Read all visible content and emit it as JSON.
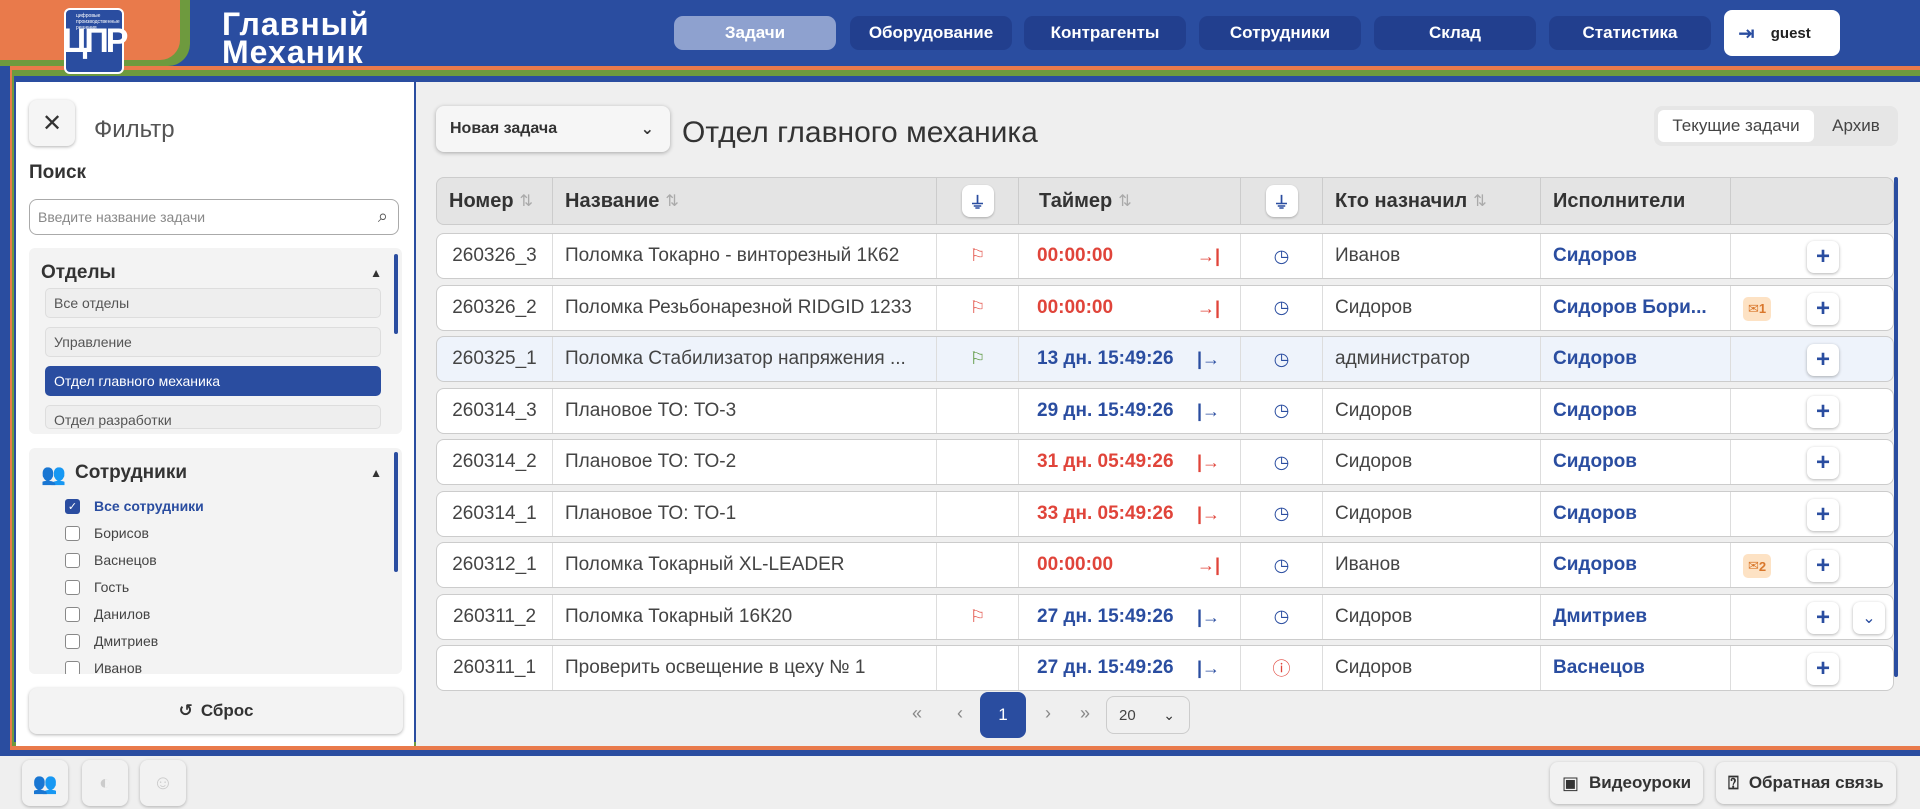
{
  "header": {
    "logo_text": "ЦПР",
    "logo_subtitle": "цифровые производственные решения",
    "brand_line1": "Главный",
    "brand_line2": "Механик",
    "nav": [
      {
        "label": "Задачи",
        "active": true
      },
      {
        "label": "Оборудование",
        "active": false
      },
      {
        "label": "Контрагенты",
        "active": false
      },
      {
        "label": "Сотрудники",
        "active": false
      },
      {
        "label": "Склад",
        "active": false
      },
      {
        "label": "Статистика",
        "active": false
      }
    ],
    "user": "guest"
  },
  "sidebar": {
    "title": "Фильтр",
    "search_label": "Поиск",
    "search_placeholder": "Введите название задачи",
    "departments_title": "Отделы",
    "departments": [
      {
        "label": "Все отделы",
        "selected": false
      },
      {
        "label": "Управление",
        "selected": false
      },
      {
        "label": "Отдел главного механика",
        "selected": true
      },
      {
        "label": "Отдел разработки",
        "selected": false
      }
    ],
    "employees_title": "Сотрудники",
    "employees": [
      {
        "label": "Все сотрудники",
        "checked": true
      },
      {
        "label": "Борисов",
        "checked": false
      },
      {
        "label": "Васнецов",
        "checked": false
      },
      {
        "label": "Гость",
        "checked": false
      },
      {
        "label": "Данилов",
        "checked": false
      },
      {
        "label": "Дмитриев",
        "checked": false
      },
      {
        "label": "Иванов",
        "checked": false
      }
    ],
    "reset_label": "Сброс"
  },
  "main": {
    "new_task_label": "Новая задача",
    "page_title": "Отдел главного механика",
    "tabs": [
      {
        "label": "Текущие задачи",
        "active": true
      },
      {
        "label": "Архив",
        "active": false
      }
    ],
    "columns": {
      "number": "Номер",
      "name": "Название",
      "timer": "Таймер",
      "assigned_by": "Кто назначил",
      "executors": "Исполнители"
    },
    "rows": [
      {
        "number": "260326_3",
        "name": "Поломка Токарно - винторезный 1К62",
        "flag": "red",
        "timer": "00:00:00",
        "timer_color": "red",
        "arrow": "→|",
        "status_icon": "clock",
        "assigned_by": "Иванов",
        "executors": "Сидоров",
        "messages": ""
      },
      {
        "number": "260326_2",
        "name": "Поломка Резьбонарезной RIDGID 1233",
        "flag": "red",
        "timer": "00:00:00",
        "timer_color": "red",
        "arrow": "→|",
        "status_icon": "clock",
        "assigned_by": "Сидоров",
        "executors": "Сидоров  Бори...",
        "messages": "1"
      },
      {
        "number": "260325_1",
        "name": "Поломка Стабилизатор напряжения ...",
        "flag": "green",
        "timer": "13 дн. 15:49:26",
        "timer_color": "blue",
        "arrow": "|→",
        "status_icon": "clock",
        "assigned_by": "администратор",
        "executors": "Сидоров",
        "messages": ""
      },
      {
        "number": "260314_3",
        "name": "Плановое ТО: ТО-3",
        "flag": "",
        "timer": "29 дн. 15:49:26",
        "timer_color": "blue",
        "arrow": "|→",
        "status_icon": "clock",
        "assigned_by": "Сидоров",
        "executors": "Сидоров",
        "messages": ""
      },
      {
        "number": "260314_2",
        "name": "Плановое ТО: ТО-2",
        "flag": "",
        "timer": "31 дн. 05:49:26",
        "timer_color": "red",
        "arrow": "|→",
        "status_icon": "clock",
        "assigned_by": "Сидоров",
        "executors": "Сидоров",
        "messages": ""
      },
      {
        "number": "260314_1",
        "name": "Плановое ТО: ТО-1",
        "flag": "",
        "timer": "33 дн. 05:49:26",
        "timer_color": "red",
        "arrow": "|→",
        "status_icon": "clock",
        "assigned_by": "Сидоров",
        "executors": "Сидоров",
        "messages": ""
      },
      {
        "number": "260312_1",
        "name": "Поломка Токарный XL-LEADER",
        "flag": "",
        "timer": "00:00:00",
        "timer_color": "red",
        "arrow": "→|",
        "status_icon": "clock",
        "assigned_by": "Иванов",
        "executors": "Сидоров",
        "messages": "2"
      },
      {
        "number": "260311_2",
        "name": "Поломка Токарный 16К20",
        "flag": "red",
        "timer": "27 дн. 15:49:26",
        "timer_color": "blue",
        "arrow": "|→",
        "status_icon": "clock",
        "assigned_by": "Сидоров",
        "executors": "Дмитриев",
        "messages": ""
      },
      {
        "number": "260311_1",
        "name": "Проверить освещение в цеху № 1",
        "flag": "",
        "timer": "27 дн. 15:49:26",
        "timer_color": "blue",
        "arrow": "|→",
        "status_icon": "alert",
        "assigned_by": "Сидоров",
        "executors": "Васнецов",
        "messages": ""
      }
    ],
    "pagination": {
      "current_page": "1",
      "page_size": "20"
    }
  },
  "footer": {
    "video_label": "Видеоуроки",
    "feedback_label": "Обратная связь"
  },
  "colors": {
    "brand": "#2a4da0",
    "orange": "#e97a4b",
    "green": "#6e9a3e",
    "red": "#e0443a"
  }
}
